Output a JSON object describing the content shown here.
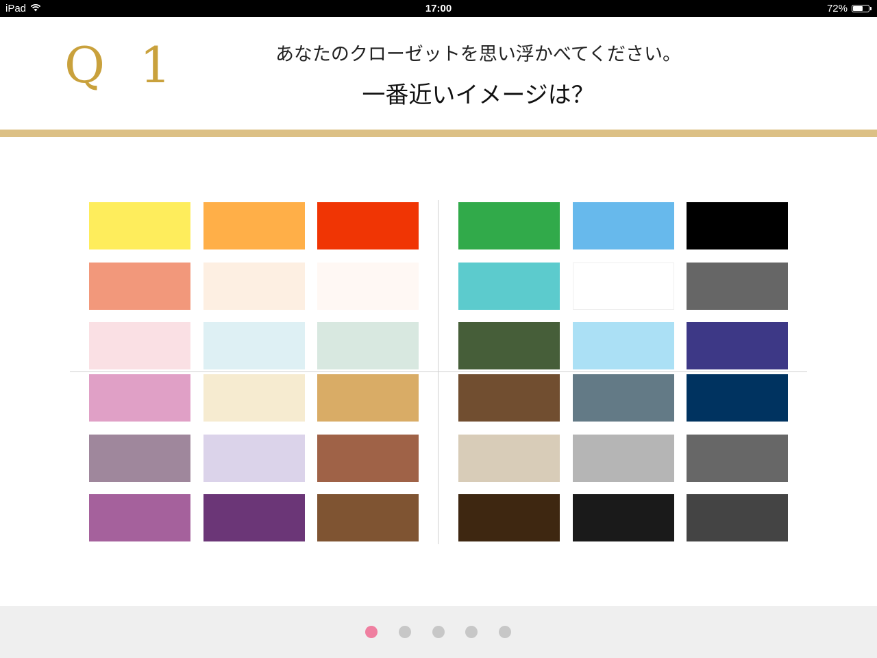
{
  "status_bar": {
    "device": "iPad",
    "time": "17:00",
    "battery_percent": "72%",
    "battery_level": 0.72,
    "wifi_icon": "wifi-icon",
    "battery_icon": "battery-icon"
  },
  "question": {
    "number": "Q 1",
    "line1": "あなたのクローゼットを思い浮かべてください。",
    "line2": "一番近いイメージは？"
  },
  "colors": {
    "accent_gold": "#c9a13c",
    "rule_gold": "#dcc085",
    "dot_active": "#ef7fa0",
    "dot_inactive": "#c7c7c7"
  },
  "palettes": [
    {
      "id": "top-left",
      "swatches": [
        "#feed5c",
        "#ffaf48",
        "#f03504",
        "#f2987b",
        "#fdefe2",
        "#fff8f4",
        "#fae0e4",
        "#def0f4",
        "#d8e8e0"
      ]
    },
    {
      "id": "top-right",
      "swatches": [
        "#31aa4a",
        "#67b9ec",
        "#000000",
        "#5ccbcd",
        "#ffffff",
        "#666666",
        "#465e39",
        "#abe0f5",
        "#3d3886"
      ]
    },
    {
      "id": "bottom-left",
      "swatches": [
        "#e0a0c6",
        "#f6ebd0",
        "#d9ac66",
        "#9f879c",
        "#dbd3ea",
        "#9f6247",
        "#a5619c",
        "#6b3677",
        "#7f5432"
      ]
    },
    {
      "id": "bottom-right",
      "swatches": [
        "#714e30",
        "#637a86",
        "#003360",
        "#d8ccb8",
        "#b5b5b5",
        "#676767",
        "#3e2711",
        "#1a1a1a",
        "#444444"
      ]
    }
  ],
  "pagination": {
    "total": 5,
    "current": 1
  }
}
